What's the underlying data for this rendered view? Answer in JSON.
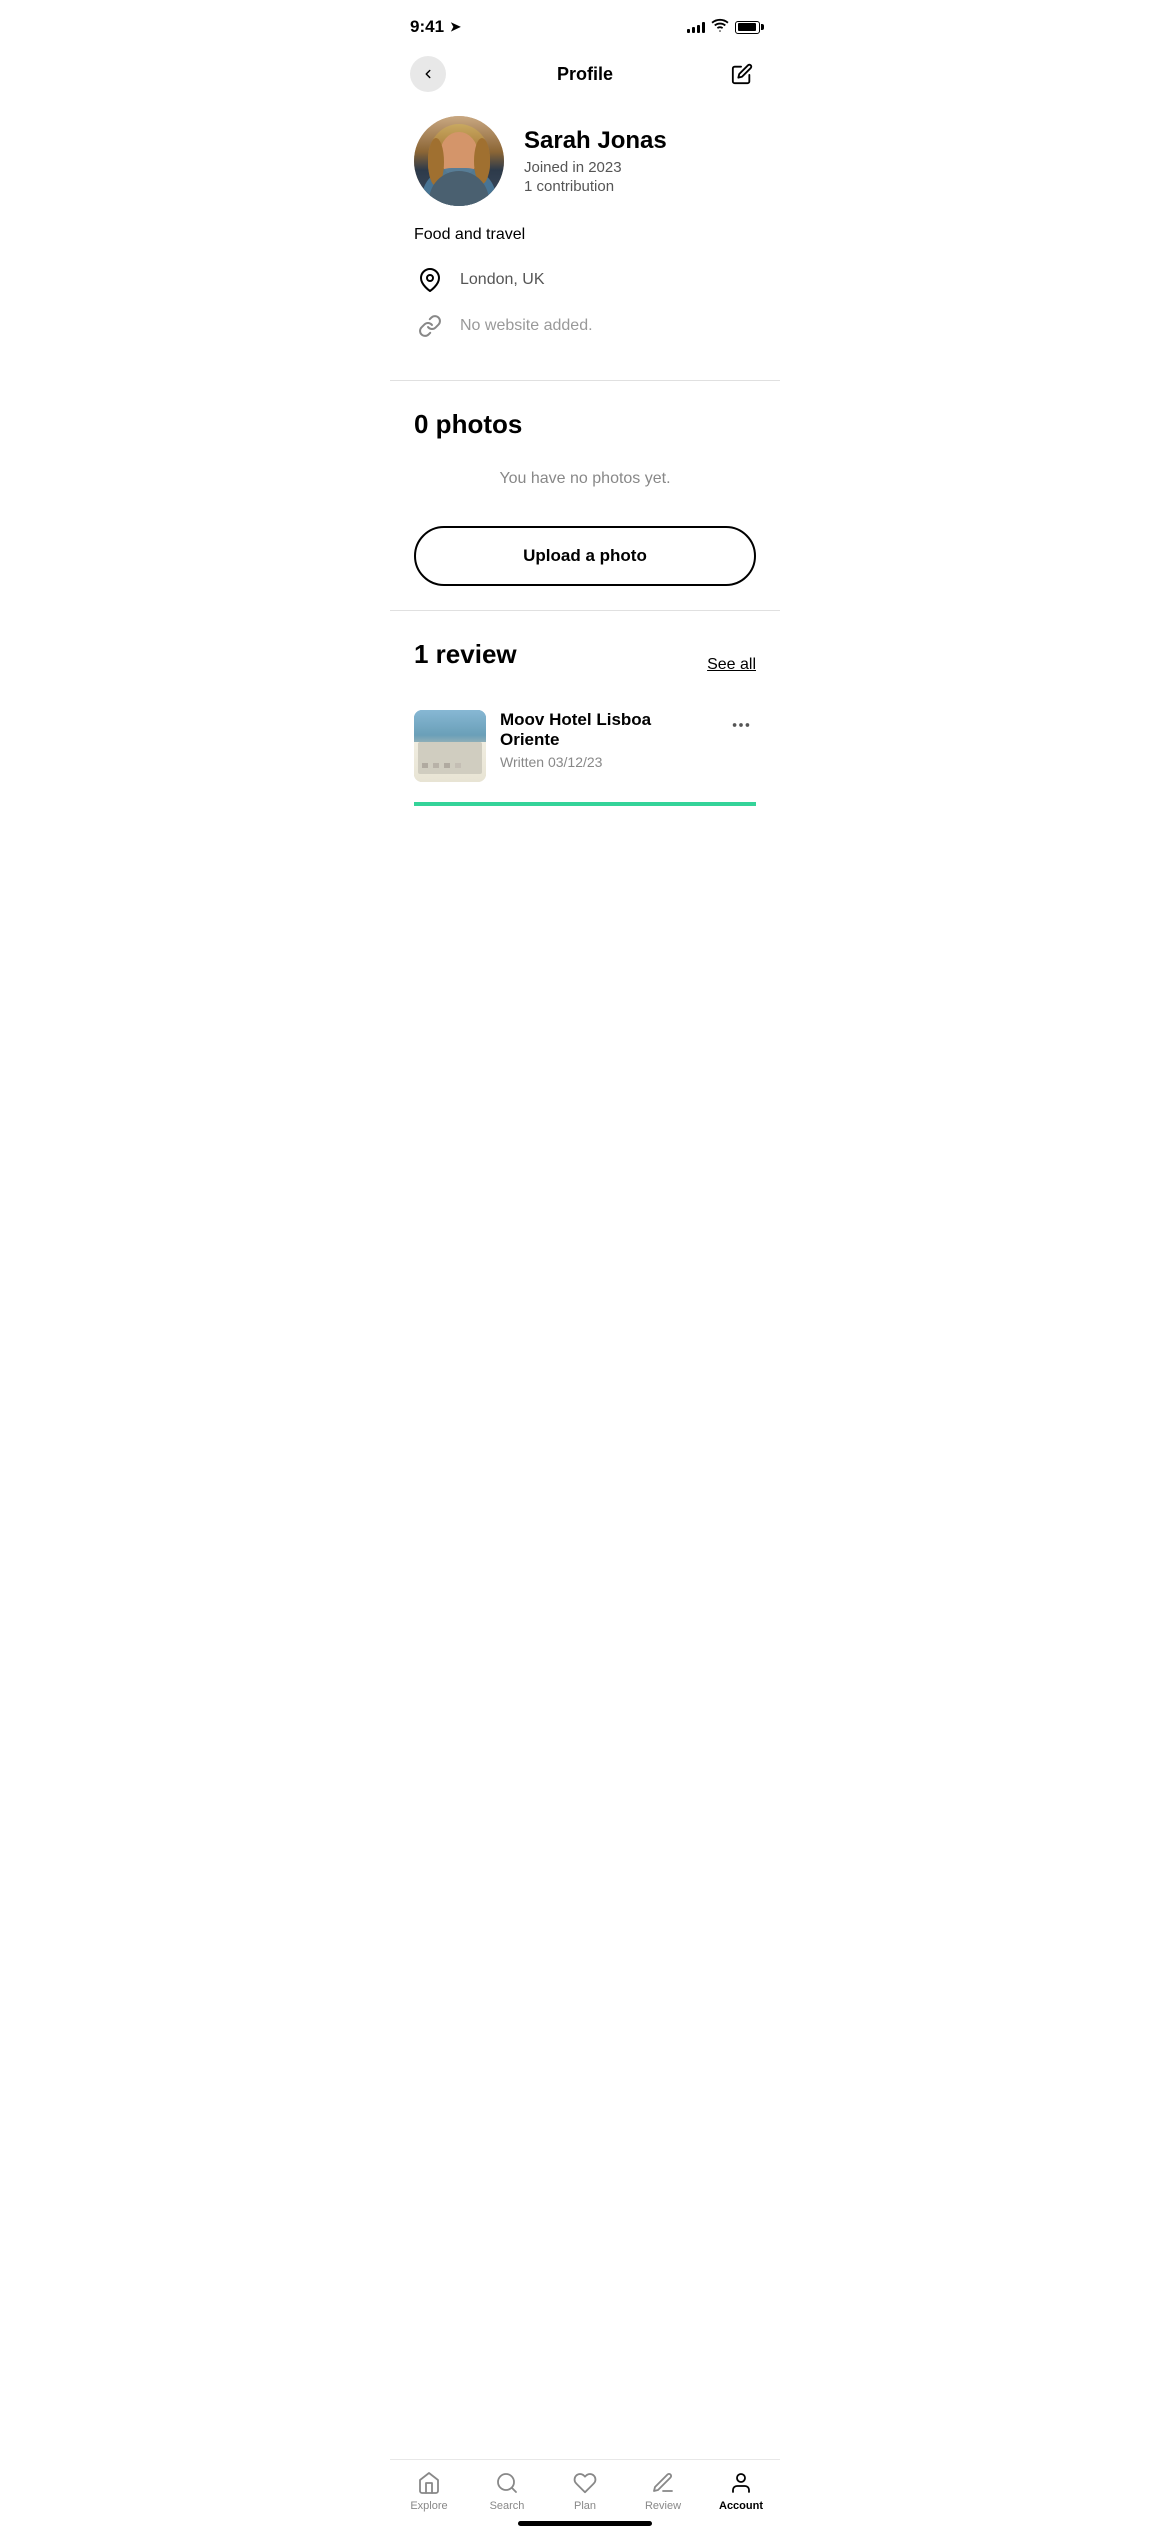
{
  "statusBar": {
    "time": "9:41",
    "locationArrow": "◀"
  },
  "header": {
    "title": "Profile",
    "backLabel": "back",
    "editLabel": "edit"
  },
  "profile": {
    "name": "Sarah Jonas",
    "joined": "Joined in 2023",
    "contributions": "1 contribution",
    "bio": "Food and travel",
    "location": "London, UK",
    "website": "No website added."
  },
  "photosSection": {
    "title": "0 photos",
    "emptyText": "You have no photos yet.",
    "uploadButton": "Upload a photo"
  },
  "reviewsSection": {
    "title": "1 review",
    "seeAll": "See all",
    "reviews": [
      {
        "hotelName": "Moov Hotel Lisboa Oriente",
        "date": "Written 03/12/23"
      }
    ]
  },
  "bottomNav": {
    "items": [
      {
        "label": "Explore",
        "icon": "home-icon",
        "active": false
      },
      {
        "label": "Search",
        "icon": "search-icon",
        "active": false
      },
      {
        "label": "Plan",
        "icon": "heart-icon",
        "active": false
      },
      {
        "label": "Review",
        "icon": "pencil-icon",
        "active": false
      },
      {
        "label": "Account",
        "icon": "account-icon",
        "active": true
      }
    ]
  }
}
